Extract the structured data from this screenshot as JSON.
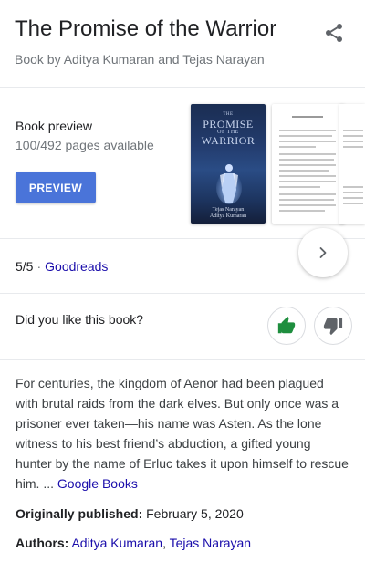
{
  "header": {
    "title": "The Promise of the Warrior",
    "subtitle": "Book by Aditya Kumaran and Tejas Narayan",
    "share_icon": "share-icon"
  },
  "preview": {
    "label": "Book preview",
    "pages": "100/492 pages available",
    "button_label": "PREVIEW",
    "button_color": "#4a74d9",
    "cover": {
      "title_small": "THE",
      "title_main": "PROMISE",
      "title_small2": "OF THE",
      "title_main2": "WARRIOR",
      "author1": "Tejas Narayan",
      "author2": "Aditya Kumaran"
    },
    "next_icon": "chevron-right-icon"
  },
  "rating": {
    "score": "5/5",
    "separator": "·",
    "source": "Goodreads"
  },
  "feedback": {
    "question": "Did you like this book?",
    "like_icon": "thumbs-up-icon",
    "dislike_icon": "thumbs-down-icon",
    "like_color": "#1e8e3e"
  },
  "description": {
    "text": "For centuries, the kingdom of Aenor had been plagued with brutal raids from the dark elves. But only once was a prisoner ever taken—his name was Asten. As the lone witness to his best friend’s abduction, a gifted young hunter by the name of Erluc takes it upon himself to rescue him. ... ",
    "source_link": "Google Books"
  },
  "facts": {
    "published_label": "Originally published:",
    "published_value": "February 5, 2020",
    "authors_label": "Authors:",
    "author1": "Aditya Kumaran",
    "author_sep": ",",
    "author2": "Tejas Narayan"
  },
  "colors": {
    "link": "#1a0dab",
    "secondary_text": "#70757a",
    "divider": "#e8eaed"
  }
}
